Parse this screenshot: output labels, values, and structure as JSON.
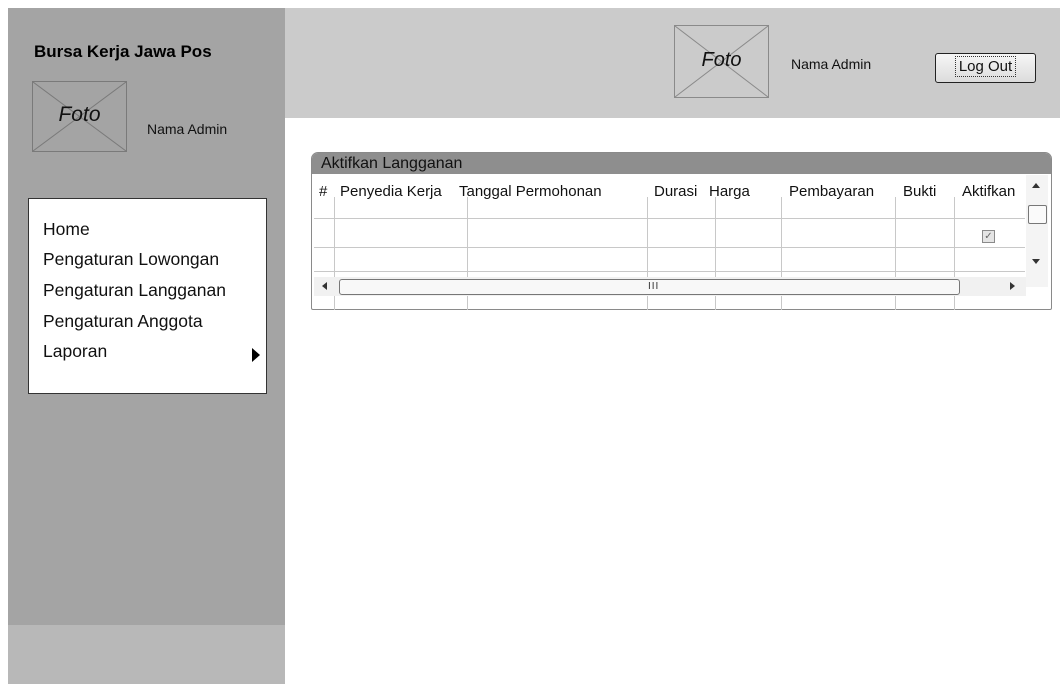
{
  "sidebar": {
    "app_title": "Bursa Kerja Jawa Pos",
    "photo_label": "Foto",
    "admin_name": "Nama Admin",
    "menu": [
      {
        "label": "Home"
      },
      {
        "label": "Pengaturan Lowongan"
      },
      {
        "label": "Pengaturan Langganan"
      },
      {
        "label": "Pengaturan Anggota",
        "has_submenu": true
      },
      {
        "label": "Laporan"
      }
    ]
  },
  "header": {
    "photo_label": "Foto",
    "admin_name": "Nama Admin",
    "logout_label": "Log Out"
  },
  "panel": {
    "title": "Aktifkan Langganan",
    "columns": [
      "#",
      "Penyedia Kerja",
      "Tanggal Permohonan",
      "Durasi",
      "Harga",
      "Pembayaran",
      "Bukti",
      "Aktifkan"
    ],
    "rows": [
      {
        "aktifkan_checked": true
      },
      {
        "aktifkan_checked": false
      }
    ],
    "hscroll_grip": "III"
  },
  "colors": {
    "sidebar_bg": "#a4a4a4",
    "header_bg": "#cbcbcb",
    "panel_title_bg": "#8e8e8e"
  }
}
